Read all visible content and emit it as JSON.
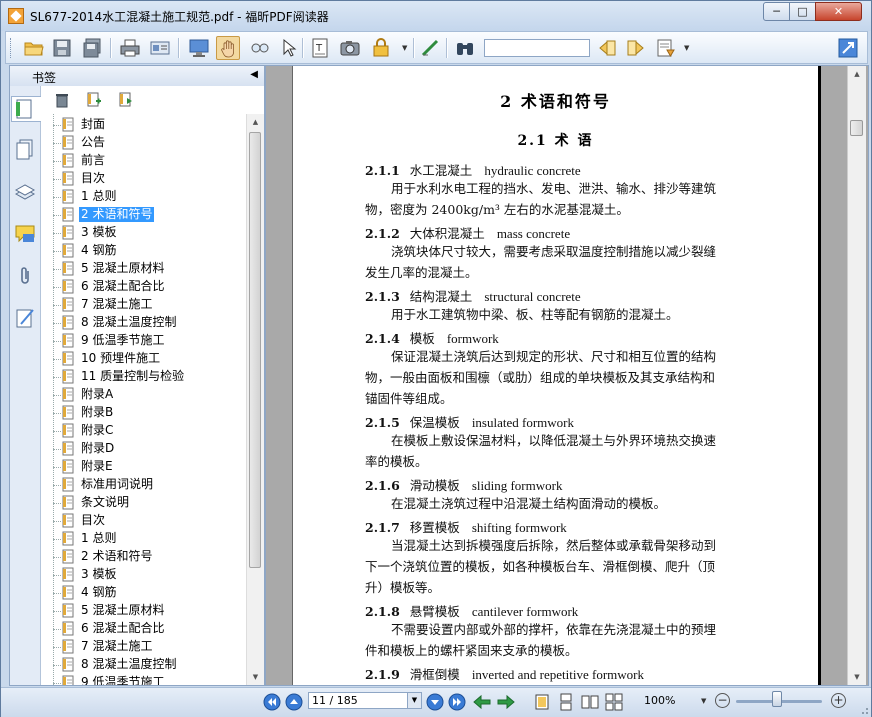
{
  "window": {
    "title": "SL677-2014水工混凝土施工规范.pdf - 福昕PDF阅读器",
    "minimize_label": "─",
    "maximize_label": "□",
    "close_label": "✕"
  },
  "toolbar": {
    "icons": [
      "open-folder-icon",
      "save-icon",
      "save-all-icon",
      "print-icon",
      "properties-icon",
      "fullscreen-icon",
      "hand-tool-icon",
      "zoom-tool-icon",
      "select-cursor-icon",
      "text-select-icon",
      "snapshot-icon",
      "rms-lock-icon",
      "typewriter-icon",
      "find-binoculars-icon",
      "search-prev-icon",
      "search-next-icon",
      "search-options-icon",
      "expand-icon"
    ],
    "search_value": "",
    "rms_label": "RMS"
  },
  "sidebar": {
    "title": "书签",
    "collapse_glyph": "◀",
    "tabs": [
      "bookmarks-tab",
      "pages-tab",
      "layers-tab",
      "comments-tab",
      "attachments-tab",
      "signatures-tab"
    ],
    "actions": [
      "delete-bookmark-icon",
      "add-bookmark-icon",
      "add-child-bookmark-icon"
    ],
    "selected_index": 5,
    "bookmarks": [
      "封面",
      "公告",
      "前言",
      "目次",
      "1 总则",
      "2 术语和符号",
      "3 模板",
      "4 钢筋",
      "5 混凝土原材料",
      "6 混凝土配合比",
      "7 混凝土施工",
      "8 混凝土温度控制",
      "9 低温季节施工",
      "10 预埋件施工",
      "11 质量控制与检验",
      "附录A",
      "附录B",
      "附录C",
      "附录D",
      "附录E",
      "标准用词说明",
      "条文说明",
      "目次",
      "1 总则",
      "2 术语和符号",
      "3 模板",
      "4 钢筋",
      "5 混凝土原材料",
      "6 混凝土配合比",
      "7 混凝土施工",
      "8 混凝土温度控制",
      "9 低温季节施工"
    ]
  },
  "document": {
    "chapter_title": "2  术语和符号",
    "section_title": "2.1  术    语",
    "terms": [
      {
        "num": "2.1.1",
        "zh": "水工混凝土",
        "en": "hydraulic concrete",
        "lines": [
          "用于水利水电工程的挡水、发电、泄洪、输水、排沙等建筑",
          "物，密度为 2400kg/m³ 左右的水泥基混凝土。"
        ]
      },
      {
        "num": "2.1.2",
        "zh": "大体积混凝土",
        "en": "mass concrete",
        "lines": [
          "浇筑块体尺寸较大，需要考虑采取温度控制措施以减少裂缝",
          "发生几率的混凝土。"
        ]
      },
      {
        "num": "2.1.3",
        "zh": "结构混凝土",
        "en": "structural concrete",
        "lines": [
          "用于水工建筑物中梁、板、柱等配有钢筋的混凝土。"
        ]
      },
      {
        "num": "2.1.4",
        "zh": "模板",
        "en": "formwork",
        "lines": [
          "保证混凝土浇筑后达到规定的形状、尺寸和相互位置的结构",
          "物，一般由面板和围檩（或肋）组成的单块模板及其支承结构和",
          "锚固件等组成。"
        ]
      },
      {
        "num": "2.1.5",
        "zh": "保温模板",
        "en": "insulated formwork",
        "lines": [
          "在模板上敷设保温材料，以降低混凝土与外界环境热交换速",
          "率的模板。"
        ]
      },
      {
        "num": "2.1.6",
        "zh": "滑动模板",
        "en": "sliding formwork",
        "lines": [
          "在混凝土浇筑过程中沿混凝土结构面滑动的模板。"
        ]
      },
      {
        "num": "2.1.7",
        "zh": "移置模板",
        "en": "shifting formwork",
        "lines": [
          "当混凝土达到拆模强度后拆除，然后整体或承载骨架移动到",
          "下一个浇筑位置的模板，如各种模板台车、滑框倒模、爬升（顶",
          "升）模板等。"
        ]
      },
      {
        "num": "2.1.8",
        "zh": "悬臂模板",
        "en": "cantilever formwork",
        "lines": [
          "不需要设置内部或外部的撑杆，依靠在先浇混凝土中的预埋",
          "件和模板上的螺杆紧固来支承的模板。"
        ]
      },
      {
        "num": "2.1.9",
        "zh": "滑框倒模",
        "en": "inverted and repetitive formwork",
        "lines": []
      }
    ]
  },
  "statusbar": {
    "page_value": "11 / 185",
    "zoom_value": "100%",
    "zoom_fraction": 0.42,
    "colors": {
      "nav_blue": "#2f6fc9",
      "nav_green": "#2a9a3a"
    }
  }
}
